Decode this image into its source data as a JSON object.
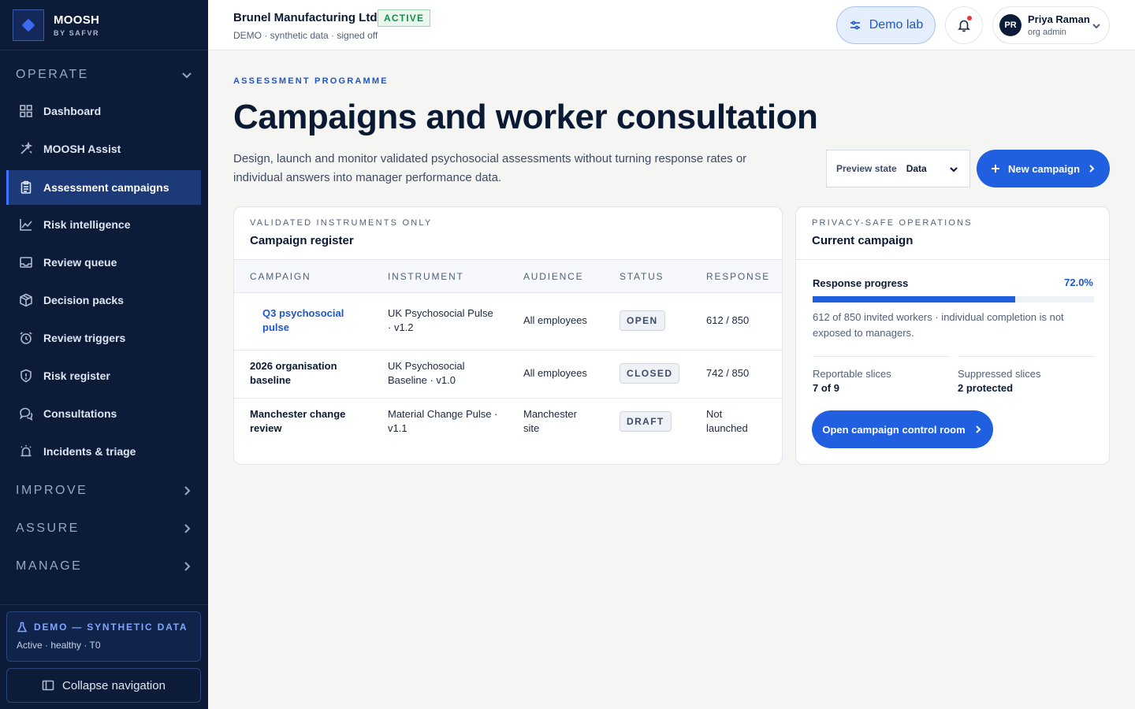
{
  "brand": {
    "name": "MOOSH",
    "sub": "BY SAFVR"
  },
  "sidebar": {
    "operate_label": "OPERATE",
    "items": [
      {
        "label": "Dashboard",
        "icon": "grid-icon"
      },
      {
        "label": "MOOSH Assist",
        "icon": "sparkle-wand-icon"
      },
      {
        "label": "Assessment campaigns",
        "icon": "clipboard-icon",
        "active": true
      },
      {
        "label": "Risk intelligence",
        "icon": "trend-chart-icon"
      },
      {
        "label": "Review queue",
        "icon": "inbox-icon"
      },
      {
        "label": "Decision packs",
        "icon": "package-icon"
      },
      {
        "label": "Review triggers",
        "icon": "alarm-clock-icon"
      },
      {
        "label": "Risk register",
        "icon": "shield-icon"
      },
      {
        "label": "Consultations",
        "icon": "chat-bubbles-icon"
      },
      {
        "label": "Incidents & triage",
        "icon": "siren-icon"
      }
    ],
    "improve_label": "IMPROVE",
    "assure_label": "ASSURE",
    "manage_label": "MANAGE",
    "demo_title": "DEMO — SYNTHETIC DATA",
    "demo_status": "Active · healthy · T0",
    "collapse_label": "Collapse navigation"
  },
  "topbar": {
    "org_name": "Brunel Manufacturing Ltd",
    "org_status": "ACTIVE",
    "org_sub": "DEMO · synthetic data · signed off",
    "demo_lab_label": "Demo lab",
    "user_initials": "PR",
    "user_name": "Priya Raman",
    "user_role": "org admin"
  },
  "main": {
    "eyebrow": "ASSESSMENT PROGRAMME",
    "title": "Campaigns and worker consultation",
    "description": "Design, launch and monitor validated psychosocial assessments without turning response rates or individual answers into manager performance data.",
    "preview_label": "Preview state",
    "preview_value": "Data",
    "new_campaign_label": "New campaign"
  },
  "register": {
    "eyebrow": "VALIDATED INSTRUMENTS ONLY",
    "title": "Campaign register",
    "columns": [
      "CAMPAIGN",
      "INSTRUMENT",
      "AUDIENCE",
      "STATUS",
      "RESPONSE"
    ],
    "rows": [
      {
        "campaign": "Q3 psychosocial pulse",
        "instrument": "UK Psychosocial Pulse · v1.2",
        "audience": "All employees",
        "status": "OPEN",
        "response": "612 / 850"
      },
      {
        "campaign": "2026 organisation baseline",
        "instrument": "UK Psychosocial Baseline · v1.0",
        "audience": "All employees",
        "status": "CLOSED",
        "response": "742 / 850"
      },
      {
        "campaign": "Manchester change review",
        "instrument": "Material Change Pulse · v1.1",
        "audience": "Manchester site",
        "status": "DRAFT",
        "response": "Not launched"
      }
    ]
  },
  "current": {
    "eyebrow": "PRIVACY-SAFE OPERATIONS",
    "title": "Current campaign",
    "progress_label": "Response progress",
    "progress_value": "72.0%",
    "progress_fraction": 0.72,
    "note": "612 of 850 invited workers · individual completion is not exposed to managers.",
    "reportable_label": "Reportable slices",
    "reportable_value": "7 of 9",
    "suppressed_label": "Suppressed slices",
    "suppressed_value": "2 protected",
    "control_room_label": "Open campaign control room"
  }
}
